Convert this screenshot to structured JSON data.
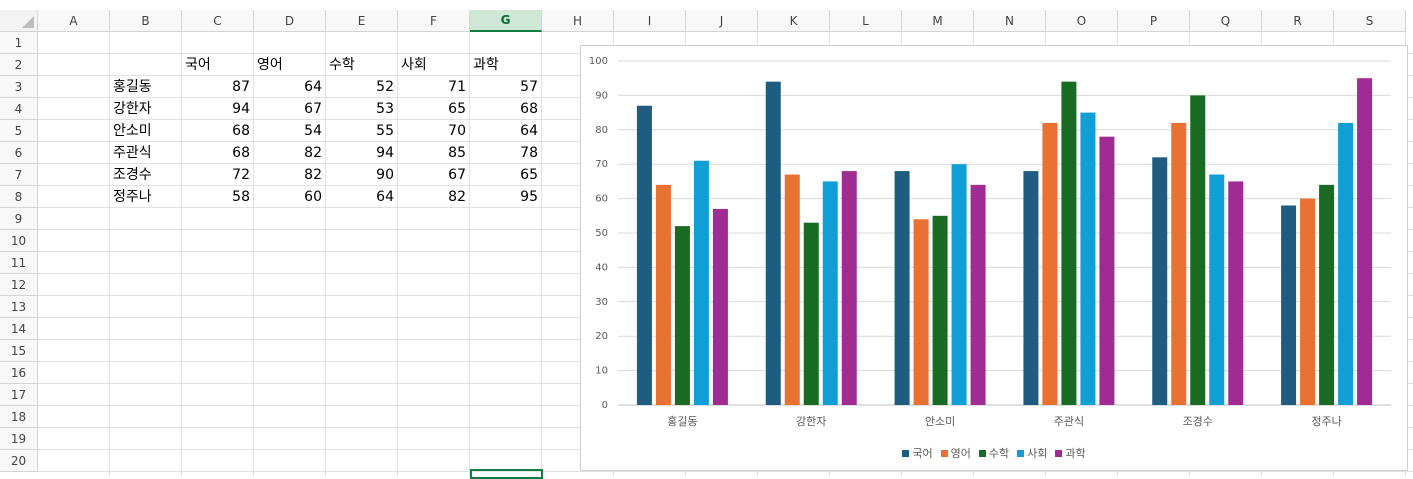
{
  "sheet": {
    "columns": [
      "A",
      "B",
      "C",
      "D",
      "E",
      "F",
      "G",
      "H",
      "I",
      "J",
      "K",
      "L",
      "M",
      "N",
      "O",
      "P",
      "Q",
      "R",
      "S"
    ],
    "selected_column": "G",
    "rows": [
      "1",
      "2",
      "3",
      "4",
      "5",
      "6",
      "7",
      "8",
      "9",
      "10",
      "11",
      "12",
      "13",
      "14",
      "15",
      "16",
      "17",
      "18",
      "19",
      "20"
    ]
  },
  "table": {
    "headers": [
      "국어",
      "영어",
      "수학",
      "사회",
      "과학"
    ],
    "rows": [
      {
        "name": "홍길동",
        "scores": [
          87,
          64,
          52,
          71,
          57
        ]
      },
      {
        "name": "강한자",
        "scores": [
          94,
          67,
          53,
          65,
          68
        ]
      },
      {
        "name": "안소미",
        "scores": [
          68,
          54,
          55,
          70,
          64
        ]
      },
      {
        "name": "주관식",
        "scores": [
          68,
          82,
          94,
          85,
          78
        ]
      },
      {
        "name": "조경수",
        "scores": [
          72,
          82,
          90,
          67,
          65
        ]
      },
      {
        "name": "정주나",
        "scores": [
          58,
          60,
          64,
          82,
          95
        ]
      }
    ]
  },
  "chart_data": {
    "type": "bar",
    "categories": [
      "홍길동",
      "강한자",
      "안소미",
      "주관식",
      "조경수",
      "정주나"
    ],
    "series": [
      {
        "name": "국어",
        "color": "#1f5c80",
        "values": [
          87,
          94,
          68,
          68,
          72,
          58
        ]
      },
      {
        "name": "영어",
        "color": "#e97132",
        "values": [
          64,
          67,
          54,
          82,
          82,
          60
        ]
      },
      {
        "name": "수학",
        "color": "#196b24",
        "values": [
          52,
          53,
          55,
          94,
          90,
          64
        ]
      },
      {
        "name": "사회",
        "color": "#0f9ed5",
        "values": [
          71,
          65,
          70,
          85,
          67,
          82
        ]
      },
      {
        "name": "과학",
        "color": "#a02b93",
        "values": [
          57,
          68,
          64,
          78,
          65,
          95
        ]
      }
    ],
    "yticks": [
      0,
      10,
      20,
      30,
      40,
      50,
      60,
      70,
      80,
      90,
      100
    ],
    "ylim": [
      0,
      100
    ],
    "grid": true,
    "legend": "bottom"
  }
}
